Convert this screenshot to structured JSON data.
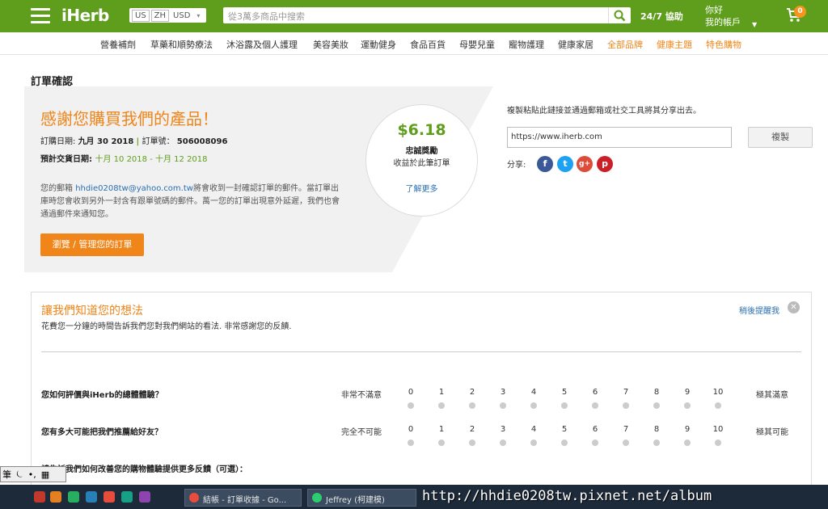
{
  "header": {
    "logo": "iHerb",
    "locale": {
      "country": "US",
      "language": "ZH",
      "currency": "USD"
    },
    "search_placeholder": "從3萬多商品中搜索",
    "help": "24/7 協助",
    "greeting": "你好",
    "account": "我的帳戶",
    "cart_count": "0"
  },
  "categories": [
    {
      "label": "營養補劑"
    },
    {
      "label": "草藥和順勢療法"
    },
    {
      "label": "沐浴露及個人護理"
    },
    {
      "label": "美容美妝"
    },
    {
      "label": "運動健身"
    },
    {
      "label": "食品百貨"
    },
    {
      "label": "母嬰兒童"
    },
    {
      "label": "寵物護理"
    },
    {
      "label": "健康家居"
    },
    {
      "label": "全部品牌"
    },
    {
      "label": "健康主題"
    },
    {
      "label": "特色購物"
    }
  ],
  "page_title": "訂單確認",
  "thanks": {
    "title": "感謝您購買我們的產品！",
    "order_date_label": "訂購日期:",
    "order_date": "九月 30 2018",
    "order_no_label": "訂單號：",
    "order_no": "506008096",
    "delivery_label": "預計交貨日期:",
    "delivery_range": "十月 10 2018 - 十月 12 2018",
    "email_prefix": "您的郵箱",
    "email": "hhdie0208tw@yahoo.com.tw",
    "email_suffix": "將會收到一封確認訂單的郵件。當訂單出庫時您會收到另外一封含有跟單號碼的郵件。萬一您的訂單出現意外延遲，我們也會通過郵件來通知您。",
    "manage_button": "瀏覽 / 管理您的訂單"
  },
  "reward": {
    "amount": "$6.18",
    "name": "忠誠獎勵",
    "sub": "收益於此筆訂單",
    "more": "了解更多"
  },
  "share": {
    "heading": "複製粘貼此鏈接並通過郵箱或社交工具將其分享出去。",
    "url": "https://www.iherb.com",
    "copy_button": "複製",
    "label": "分享:"
  },
  "feedback": {
    "title": "讓我們知道您的想法",
    "subtitle": "花費您一分鐘的時間告訴我們您對我們網站的看法. 非常感謝您的反饋.",
    "remind": "稍後提醒我",
    "q1": "您如何評價與iHerb的總體體驗？",
    "q1_low": "非常不滿意",
    "q1_high": "極其滿意",
    "q2": "您有多大可能把我們推薦給好友？",
    "q2_low": "完全不可能",
    "q2_high": "極其可能",
    "q3": "請告訴我們如何改善您的購物體驗提供更多反饋（可選）：",
    "scale": [
      "0",
      "1",
      "2",
      "3",
      "4",
      "5",
      "6",
      "7",
      "8",
      "9",
      "10"
    ]
  },
  "ime": {
    "a": "筆",
    "b": "⏾",
    "c": "•,",
    "d": "▦"
  },
  "taskbar": {
    "task1": "結帳 - 訂單收據 - Go...",
    "task2": "Jeffrey (柯建模)"
  },
  "watermark": "http://hhdie0208tw.pixnet.net/album",
  "colors": {
    "brand_green": "#5f9e1c",
    "accent_orange": "#f08519",
    "link_blue": "#2a6fb0"
  }
}
